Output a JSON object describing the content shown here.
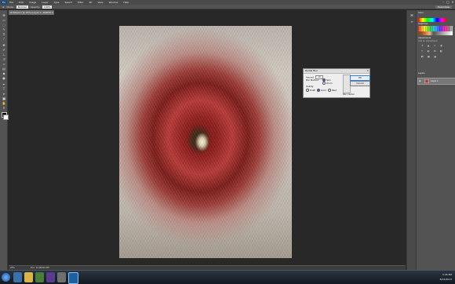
{
  "app": {
    "logo": "Ps"
  },
  "menu": [
    "File",
    "Edit",
    "Image",
    "Layer",
    "Type",
    "Select",
    "Filter",
    "3D",
    "View",
    "Window",
    "Help"
  ],
  "window_controls": [
    "–",
    "□",
    "✕"
  ],
  "options": {
    "mode_label": "Mode:",
    "mode_value": "Normal",
    "opacity_label": "Opacity:",
    "opacity_value": "100%",
    "workspace": "Essentials"
  },
  "doc_tab": {
    "title": "Untitled-1 @ 25% (Layer 1, RGB/8)",
    "close": "✕"
  },
  "tools": [
    "move-icon",
    "marquee-icon",
    "lasso-icon",
    "quick-select-icon",
    "crop-icon",
    "eyedropper-icon",
    "heal-icon",
    "brush-icon",
    "stamp-icon",
    "history-brush-icon",
    "eraser-icon",
    "gradient-icon",
    "blur-icon",
    "dodge-icon",
    "pen-icon",
    "type-icon",
    "path-select-icon",
    "shape-icon",
    "hand-icon",
    "zoom-icon"
  ],
  "dialog": {
    "title": "Radial Blur",
    "close": "✕",
    "amount_label": "Amount",
    "amount_value": "10",
    "blur_method_label": "Blur Method:",
    "method_spin": "Spin",
    "method_zoom": "Zoom",
    "quality_label": "Quality:",
    "quality_draft": "Draft",
    "quality_good": "Good",
    "quality_best": "Best",
    "blur_center_label": "Blur Center",
    "ok": "OK",
    "cancel": "Cancel"
  },
  "panels": {
    "color_tab": "Color",
    "swatches_tab": "Swatches",
    "adjustments_tab": "Adjustments",
    "adjustments_sub": "Add an adjustment",
    "layers_tab": "Layers",
    "layer_name": "Layer 1"
  },
  "status": {
    "zoom": "25%",
    "doc": "Doc: 12.0M/12.0M"
  },
  "taskbar": {
    "time": "3:45 PM",
    "date": "6/12/2013"
  },
  "colors": {
    "accent": "#3c7fd8",
    "ui_dark": "#282828",
    "panel": "#535353"
  }
}
